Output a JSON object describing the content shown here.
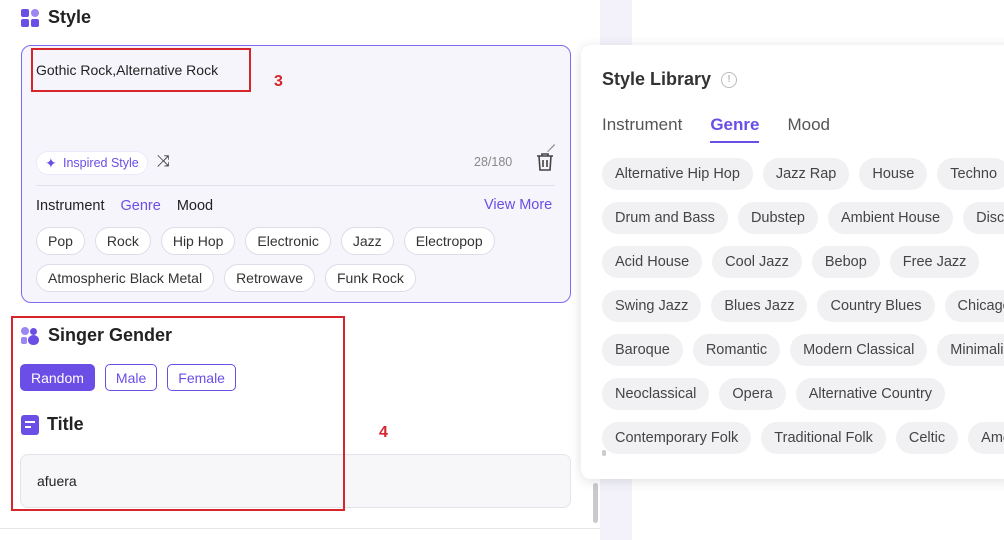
{
  "style_section": {
    "title": "Style",
    "text_value": "Gothic Rock,Alternative Rock",
    "inspired_label": "Inspired Style",
    "char_count": "28/180",
    "tabs": [
      "Instrument",
      "Genre",
      "Mood"
    ],
    "view_more": "View More",
    "tags_row1": [
      "Pop",
      "Rock",
      "Hip Hop",
      "Electronic",
      "Jazz",
      "Electropop"
    ],
    "tags_row2": [
      "Atmospheric Black Metal",
      "Retrowave",
      "Funk Rock"
    ]
  },
  "singer_section": {
    "title": "Singer Gender",
    "options": [
      "Random",
      "Male",
      "Female"
    ],
    "selected": "Random"
  },
  "title_section": {
    "title": "Title",
    "value": "afuera"
  },
  "annotations": {
    "label_3": "3",
    "label_4": "4"
  },
  "library": {
    "title": "Style Library",
    "tabs": [
      "Instrument",
      "Genre",
      "Mood"
    ],
    "active_tab": "Genre",
    "rows": [
      [
        "Alternative Hip Hop",
        "Jazz Rap",
        "House",
        "Techno"
      ],
      [
        "Drum and Bass",
        "Dubstep",
        "Ambient House",
        "Disco"
      ],
      [
        "Acid House",
        "Cool Jazz",
        "Bebop",
        "Free Jazz"
      ],
      [
        "Swing Jazz",
        "Blues Jazz",
        "Country Blues",
        "Chicago Blues"
      ],
      [
        "Baroque",
        "Romantic",
        "Modern Classical",
        "Minimalism"
      ],
      [
        "Neoclassical",
        "Opera",
        "Alternative Country"
      ],
      [
        "Contemporary Folk",
        "Traditional Folk",
        "Celtic",
        "Americana"
      ]
    ]
  },
  "colors": {
    "accent": "#6b4ee6",
    "annotation": "#d6252b"
  }
}
